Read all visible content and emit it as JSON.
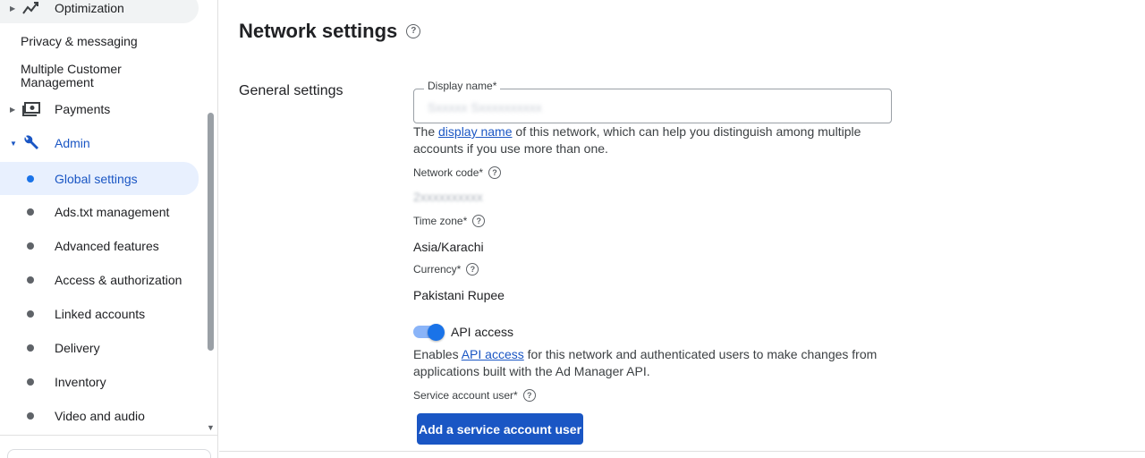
{
  "sidebar": {
    "optimization": {
      "label": "Optimization",
      "icon": "trend-line-icon"
    },
    "privacy": {
      "label": "Privacy & messaging"
    },
    "mcm": {
      "label": "Multiple Customer Management"
    },
    "payments": {
      "label": "Payments",
      "icon": "payments-icon"
    },
    "admin": {
      "label": "Admin",
      "icon": "wrench-icon"
    },
    "admin_items": [
      {
        "label": "Global settings",
        "selected": true
      },
      {
        "label": "Ads.txt management"
      },
      {
        "label": "Advanced features"
      },
      {
        "label": "Access & authorization"
      },
      {
        "label": "Linked accounts"
      },
      {
        "label": "Delivery"
      },
      {
        "label": "Inventory"
      },
      {
        "label": "Video and audio"
      }
    ]
  },
  "main": {
    "title": "Network settings",
    "section_title": "General settings",
    "display_name": {
      "label": "Display name*",
      "value": "Sxxxxx Sxxxxxxxxxx",
      "helper_pre": "The ",
      "helper_link": "display name",
      "helper_post": " of this network, which can help you distinguish among multiple accounts if you use more than one."
    },
    "network_code": {
      "label": "Network code*",
      "value": "2xxxxxxxxxx"
    },
    "time_zone": {
      "label": "Time zone*",
      "value": "Asia/Karachi"
    },
    "currency": {
      "label": "Currency*",
      "value": "Pakistani Rupee"
    },
    "api_access": {
      "label": "API access",
      "enabled": true,
      "helper_pre": "Enables ",
      "helper_link": "API access",
      "helper_post": " for this network and authenticated users to make changes from applications built with the Ad Manager API."
    },
    "service_account": {
      "label": "Service account user*",
      "button_label": "Add a service account user"
    }
  },
  "colors": {
    "accent": "#1a73e8",
    "button": "#1a56c4",
    "selected_bg": "#e8f0fe"
  }
}
